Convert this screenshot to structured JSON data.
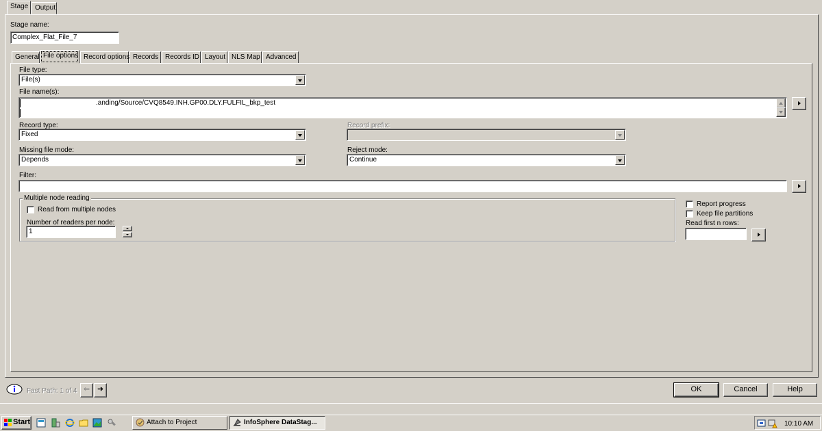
{
  "top_tabs": [
    {
      "label": "Stage",
      "active": true
    },
    {
      "label": "Output",
      "active": false
    }
  ],
  "stage_name": {
    "label": "Stage name:",
    "value": "Complex_Flat_File_7"
  },
  "sub_tabs": [
    "General",
    "File options",
    "Record options",
    "Records",
    "Records ID",
    "Layout",
    "NLS Map",
    "Advanced"
  ],
  "active_sub_tab": "File options",
  "file_options": {
    "file_type": {
      "label": "File type:",
      "value": "File(s)"
    },
    "file_names": {
      "label": "File name(s):",
      "value": ".anding/Source/CVQ8549.INH.GP00.DLY.FULFIL_bkp_test"
    },
    "record_type": {
      "label": "Record type:",
      "value": "Fixed"
    },
    "record_prefix": {
      "label": "Record prefix:",
      "value": ""
    },
    "missing_file_mode": {
      "label": "Missing file mode:",
      "value": "Depends"
    },
    "reject_mode": {
      "label": "Reject mode:",
      "value": "Continue"
    },
    "filter": {
      "label": "Filter:",
      "value": ""
    },
    "multiple_node_reading": {
      "legend": "Multiple node reading",
      "read_from_multiple_nodes": {
        "label": "Read from multiple nodes",
        "checked": false
      },
      "readers_per_node": {
        "label": "Number of readers per node:",
        "value": "1"
      }
    },
    "report_progress": {
      "label": "Report progress",
      "checked": false
    },
    "keep_file_partitions": {
      "label": "Keep file partitions",
      "checked": false
    },
    "read_first_n_rows": {
      "label": "Read first n rows:",
      "value": ""
    }
  },
  "footer": {
    "fast_path": "Fast Path: 1 of 4",
    "ok": "OK",
    "cancel": "Cancel",
    "help": "Help"
  },
  "taskbar": {
    "start": "Start",
    "buttons": [
      "Attach to Project",
      "InfoSphere DataStag..."
    ],
    "active_button": "InfoSphere DataStag...",
    "clock": "10:10 AM"
  },
  "colors": {
    "face": "#d4d0c8",
    "shadow": "#808080",
    "highlight": "#ffffff",
    "field": "#ffffff"
  }
}
